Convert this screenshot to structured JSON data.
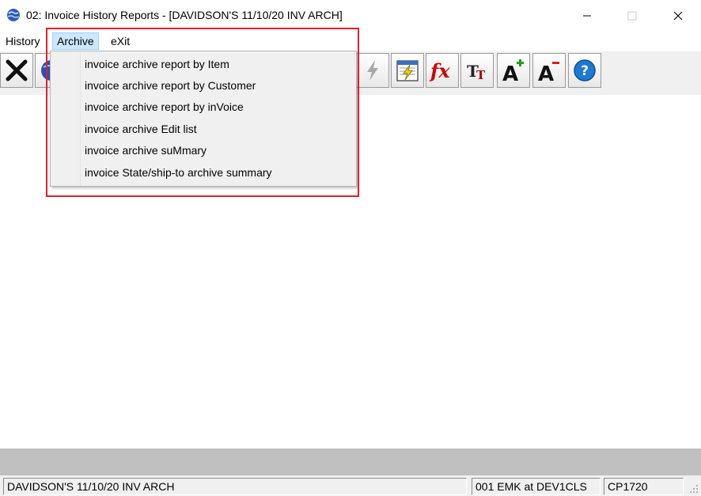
{
  "window": {
    "title": "02: Invoice History Reports - [DAVIDSON'S 11/10/20 INV ARCH]",
    "controls": {
      "minimize": "–",
      "maximize": "☐",
      "close": "✕"
    }
  },
  "menubar": {
    "items": [
      {
        "label": "History",
        "active": false
      },
      {
        "label": "Archive",
        "active": true
      },
      {
        "label": "eXit",
        "active": false
      }
    ]
  },
  "archive_menu": {
    "items": [
      {
        "label": "invoice archive report by Item"
      },
      {
        "label": "invoice archive report by Customer"
      },
      {
        "label": "invoice archive report by inVoice"
      },
      {
        "label": "invoice archive Edit list"
      },
      {
        "label": "invoice archive suMmary"
      },
      {
        "label": "invoice State/ship-to archive summary"
      }
    ]
  },
  "toolbar": {
    "buttons": [
      {
        "icon": "close-x-icon"
      },
      {
        "icon": "globe-icon"
      },
      {
        "icon": "lightning-icon"
      },
      {
        "icon": "calculator-lightning-icon"
      },
      {
        "icon": "function-fx-icon"
      },
      {
        "icon": "font-size-icon"
      },
      {
        "icon": "increase-font-icon"
      },
      {
        "icon": "decrease-font-icon"
      },
      {
        "icon": "help-icon"
      }
    ]
  },
  "statusbar": {
    "company": "DAVIDSON'S 11/10/20 INV ARCH",
    "user": "001 EMK at DEV1CLS",
    "code": "CP1720"
  },
  "colors": {
    "highlight_border": "#e0202a",
    "menu_active_bg": "#cce8ff",
    "accent_red": "#d40000",
    "help_blue": "#1f78d1"
  }
}
